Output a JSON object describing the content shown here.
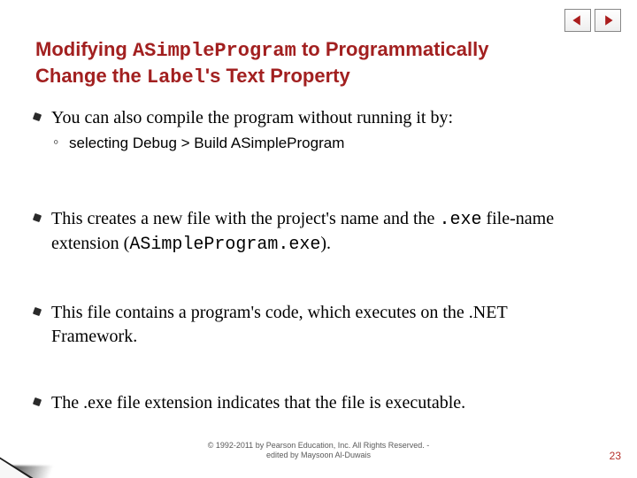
{
  "nav": {
    "prev_icon": "triangle-left",
    "next_icon": "triangle-right"
  },
  "title": {
    "pre": "Modifying ",
    "code1": "ASimpleProgram",
    "mid": " to Programmatically Change the ",
    "code2": "Label",
    "post": "'s Text Property"
  },
  "bullets": {
    "b1": "You can also compile the program without running it by:",
    "b1_sub": "selecting Debug > Build ASimpleProgram",
    "b2_a": "This creates a new file with the project's name and the ",
    "b2_code1": ".exe",
    "b2_b": " file-name extension (",
    "b2_code2": "ASimpleProgram.exe",
    "b2_c": ").",
    "b3": "This file contains a program's code, which executes on the .NET Framework.",
    "b4": "The .exe file extension indicates that the file is executable."
  },
  "footer": {
    "line1": "© 1992-2011 by Pearson Education, Inc. All Rights Reserved. -",
    "line2": "edited by Maysoon Al-Duwais"
  },
  "page_number": "23"
}
